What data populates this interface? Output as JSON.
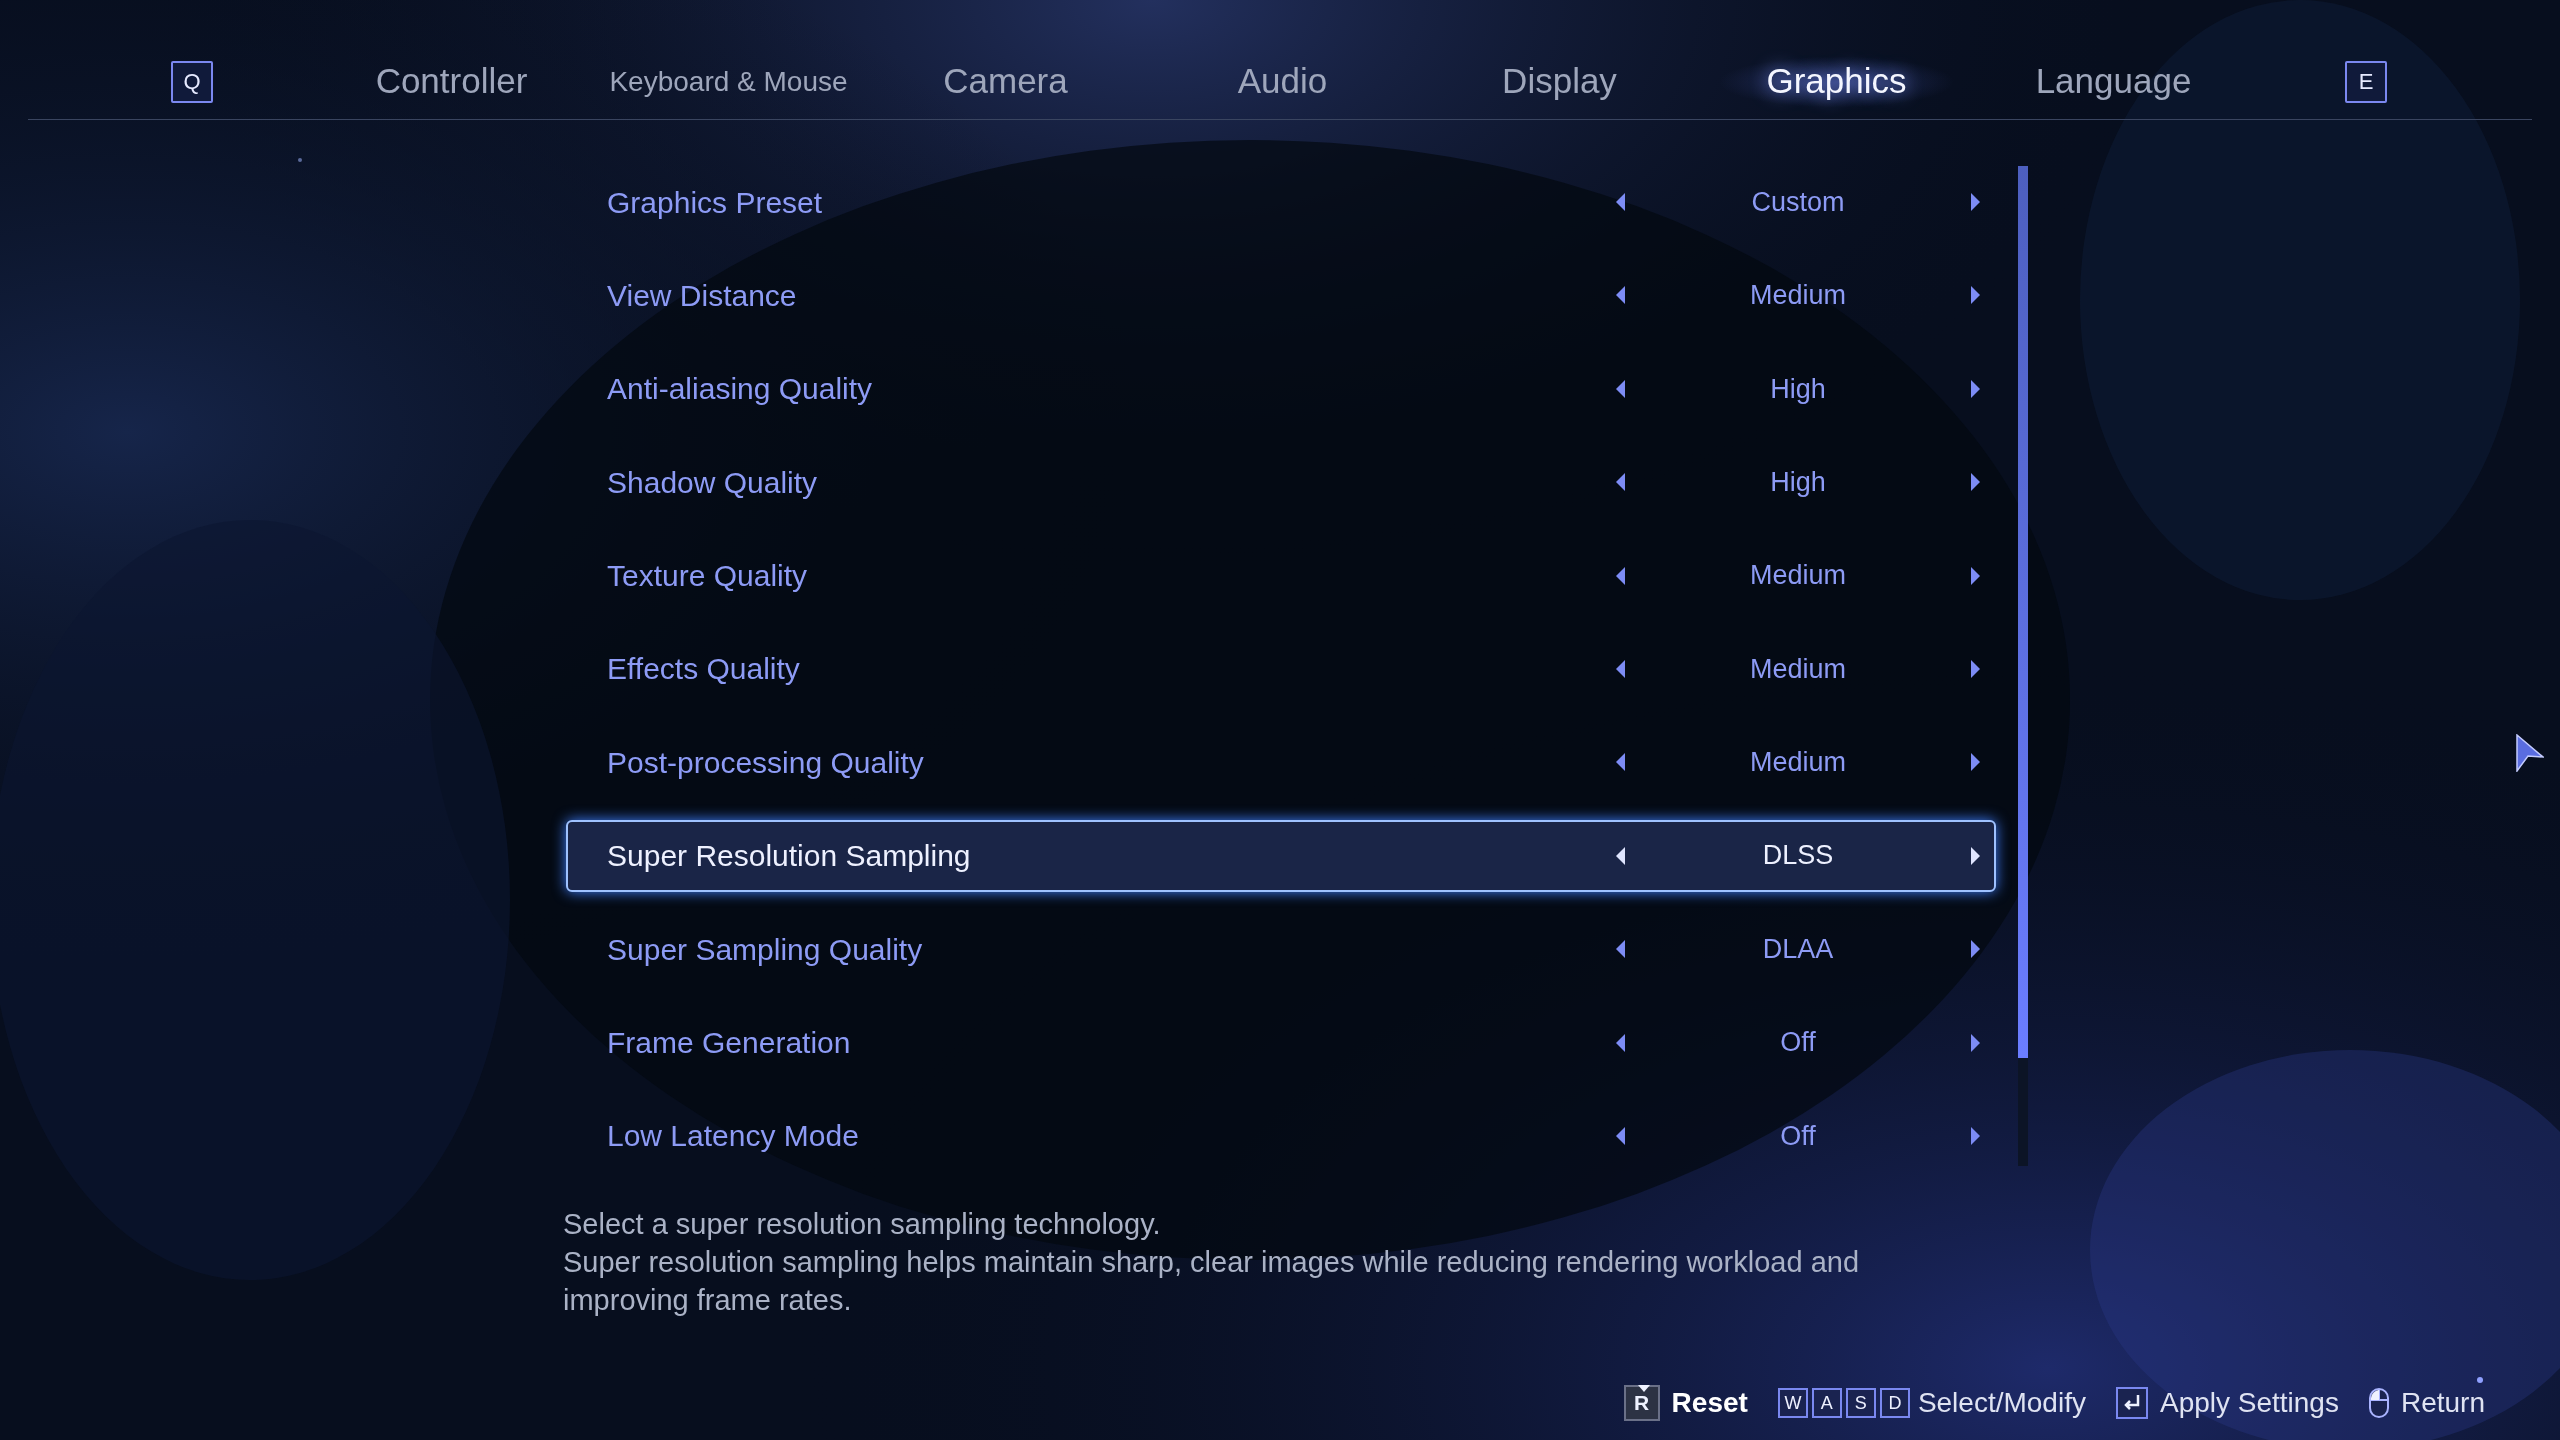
{
  "tabs": {
    "prev_key": "Q",
    "next_key": "E",
    "items": [
      {
        "label": "Controller",
        "selected": false
      },
      {
        "label": "Keyboard & Mouse",
        "selected": false
      },
      {
        "label": "Camera",
        "selected": false
      },
      {
        "label": "Audio",
        "selected": false
      },
      {
        "label": "Display",
        "selected": false
      },
      {
        "label": "Graphics",
        "selected": true
      },
      {
        "label": "Language",
        "selected": false
      }
    ]
  },
  "settings": [
    {
      "label": "Graphics Preset",
      "value": "Custom",
      "selected": false
    },
    {
      "label": "View Distance",
      "value": "Medium",
      "selected": false
    },
    {
      "label": "Anti-aliasing Quality",
      "value": "High",
      "selected": false
    },
    {
      "label": "Shadow Quality",
      "value": "High",
      "selected": false
    },
    {
      "label": "Texture Quality",
      "value": "Medium",
      "selected": false
    },
    {
      "label": "Effects Quality",
      "value": "Medium",
      "selected": false
    },
    {
      "label": "Post-processing Quality",
      "value": "Medium",
      "selected": false
    },
    {
      "label": "Super Resolution Sampling",
      "value": "DLSS",
      "selected": true
    },
    {
      "label": "Super Sampling Quality",
      "value": "DLAA",
      "selected": false
    },
    {
      "label": "Frame Generation",
      "value": "Off",
      "selected": false
    },
    {
      "label": "Low Latency Mode",
      "value": "Off",
      "selected": false
    }
  ],
  "description": [
    "Select a super resolution sampling technology.",
    "Super resolution sampling helps maintain sharp, clear images while reducing rendering workload and improving frame rates."
  ],
  "footer": [
    {
      "kind": "hold-key",
      "keys": [
        "R"
      ],
      "label": "Reset",
      "emphasized": true
    },
    {
      "kind": "key",
      "keys": [
        "W",
        "A",
        "S",
        "D"
      ],
      "label": "Select/Modify",
      "emphasized": false
    },
    {
      "kind": "enter",
      "label": "Apply Settings",
      "emphasized": false
    },
    {
      "kind": "mouse",
      "label": "Return",
      "emphasized": false
    }
  ]
}
